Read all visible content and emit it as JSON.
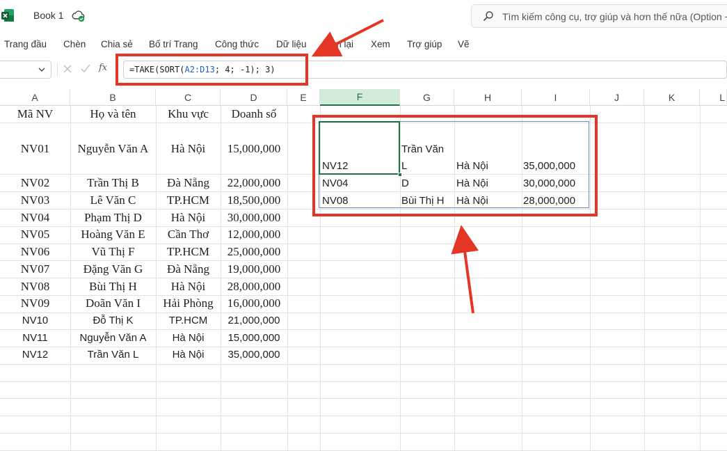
{
  "title_bar": {
    "book_name": "Book 1",
    "search_placeholder": "Tìm kiếm công cụ, trợ giúp và hơn thế nữa (Option +"
  },
  "menu": [
    "Trang đầu",
    "Chèn",
    "Chia sẻ",
    "Bố trí Trang",
    "Công thức",
    "Dữ liệu",
    "Xem lại",
    "Xem",
    "Trợ giúp",
    "Vẽ"
  ],
  "formula_bar": {
    "fx_label": "fx",
    "formula_parts": [
      "=TAKE(SORT(",
      "A2:D13",
      "; 4; -1); 3)"
    ]
  },
  "columns": [
    "A",
    "B",
    "C",
    "D",
    "E",
    "F",
    "G",
    "H",
    "I",
    "J",
    "K",
    "L"
  ],
  "active_column": "F",
  "table": {
    "headers": [
      "Mã NV",
      "Họ và tên",
      "Khu vực",
      "Doanh số"
    ],
    "rows": [
      [
        "NV01",
        "Nguyễn Văn A",
        "Hà Nội",
        "15,000,000"
      ],
      [
        "NV02",
        "Trần Thị B",
        "Đà Nẵng",
        "22,000,000"
      ],
      [
        "NV03",
        "Lê Văn C",
        "TP.HCM",
        "18,500,000"
      ],
      [
        "NV04",
        "Phạm Thị D",
        "Hà Nội",
        "30,000,000"
      ],
      [
        "NV05",
        "Hoàng Văn E",
        "Cần Thơ",
        "12,000,000"
      ],
      [
        "NV06",
        "Vũ Thị F",
        "TP.HCM",
        "25,000,000"
      ],
      [
        "NV07",
        "Đặng Văn G",
        "Đà Nẵng",
        "19,000,000"
      ],
      [
        "NV08",
        "Bùi Thị H",
        "Hà Nội",
        "28,000,000"
      ],
      [
        "NV09",
        "Doãn Văn I",
        "Hải Phòng",
        "16,000,000"
      ],
      [
        "NV10",
        "Đỗ Thị K",
        "TP.HCM",
        "21,000,000"
      ],
      [
        "NV11",
        "Nguyễn Văn A",
        "Hà Nội",
        "15,000,000"
      ],
      [
        "NV12",
        "Trần Văn L",
        "Hà Nội",
        "35,000,000"
      ]
    ]
  },
  "result": {
    "rows": [
      [
        "NV12",
        "Trần Văn",
        "L",
        "Hà Nội",
        "35,000,000"
      ],
      [
        "NV04",
        "D",
        "Hà Nội",
        "30,000,000"
      ],
      [
        "NV08",
        "Bùi Thị H",
        "Hà Nội",
        "28,000,000"
      ]
    ]
  },
  "colors": {
    "annotation_red": "#e53524",
    "excel_green": "#217346",
    "reference_blue": "#1f5fbf"
  }
}
